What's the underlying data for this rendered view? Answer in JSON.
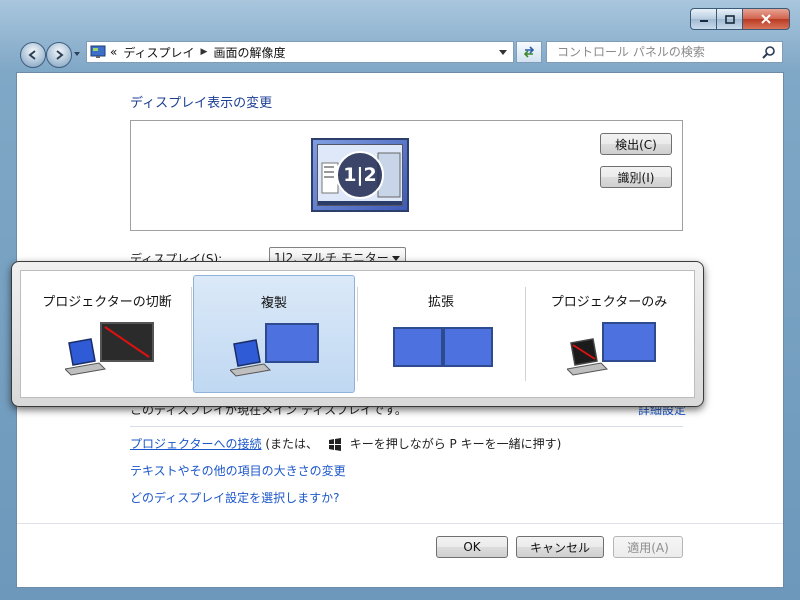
{
  "window": {
    "controls": {
      "minimize_icon": "minimize-icon",
      "maximize_icon": "maximize-icon",
      "close_icon": "close-icon"
    }
  },
  "navigation": {
    "breadcrumb_overflow": "«",
    "crumbs": [
      "ディスプレイ",
      "画面の解像度"
    ],
    "search_placeholder": "コントロール パネルの検索"
  },
  "main": {
    "heading": "ディスプレイ表示の変更",
    "preview_monitor_label": "1|2",
    "detect_button": "検出(C)",
    "identify_button": "識別(I)",
    "display_label": "ディスプレイ(S):",
    "display_value": "1|2. マルチ モニター",
    "status_text": "このディスプレイが現在メイン ディスプレイです。",
    "advanced_link": "詳細設定",
    "projector_link": "プロジェクターへの接続",
    "projector_hint_pre": "(または、",
    "projector_hint_post": "キーを押しながら P キーを一緒に押す)",
    "text_size_link": "テキストやその他の項目の大きさの変更",
    "which_setting_link": "どのディスプレイ設定を選択しますか?"
  },
  "footer": {
    "ok": "OK",
    "cancel": "キャンセル",
    "apply": "適用(A)"
  },
  "projector_flyout": {
    "options": [
      {
        "label": "プロジェクターの切断",
        "selected": false
      },
      {
        "label": "複製",
        "selected": true
      },
      {
        "label": "拡張",
        "selected": false
      },
      {
        "label": "プロジェクターのみ",
        "selected": false
      }
    ]
  },
  "colors": {
    "link": "#1c57c9",
    "heading": "#1c3f94",
    "selection": "#c0d8f2"
  }
}
